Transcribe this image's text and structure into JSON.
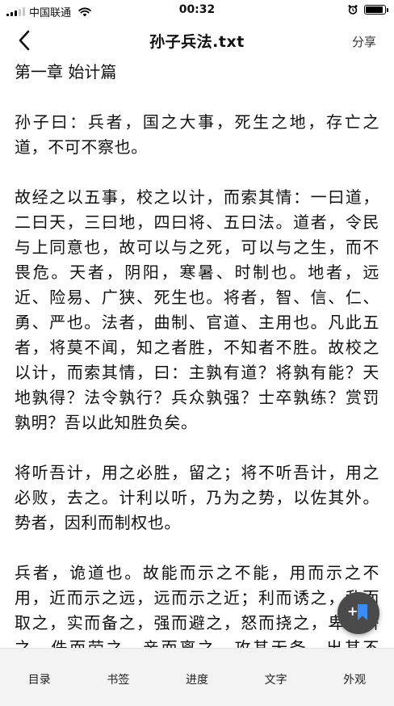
{
  "status_bar": {
    "carrier": "中国联通",
    "time": "00:32",
    "battery_level": 0.92
  },
  "nav": {
    "title": "孙子兵法.txt",
    "share_label": "分享"
  },
  "reader": {
    "chapter_title": "第一章 始计篇",
    "paragraphs": [
      "孙子曰：兵者，国之大事，死生之地，存亡之道，不可不察也。",
      "故经之以五事，校之以计，而索其情：一曰道，二曰天，三曰地，四曰将、五曰法。道者，令民与上同意也，故可以与之死，可以与之生，而不畏危。天者，阴阳，寒暑、时制也。地者，远近、险易、广狭、死生也。将者，智、信、仁、勇、严也。法者，曲制、官道、主用也。凡此五者，将莫不闻，知之者胜，不知者不胜。故校之以计，而索其情，曰：主孰有道？将孰有能？天地孰得？法令孰行？兵众孰强？士卒孰练？赏罚孰明？吾以此知胜负矣。",
      "将听吾计，用之必胜，留之；将不听吾计，用之必败，去之。计利以听，乃为之势，以佐其外。势者，因利而制权也。",
      "兵者，诡道也。故能而示之不能，用而示之不用，近而示之远，远而示之近；利而诱之，乱而取之，实而备之，强而避之，怒而挠之，卑而骄之，佚而劳之，亲而离之。攻其无备，出其不意，此兵家之胜，不可先传也。"
    ]
  },
  "fab": {
    "plus": "+"
  },
  "toolbar": {
    "items": [
      "目录",
      "书签",
      "进度",
      "文字",
      "外观"
    ]
  }
}
